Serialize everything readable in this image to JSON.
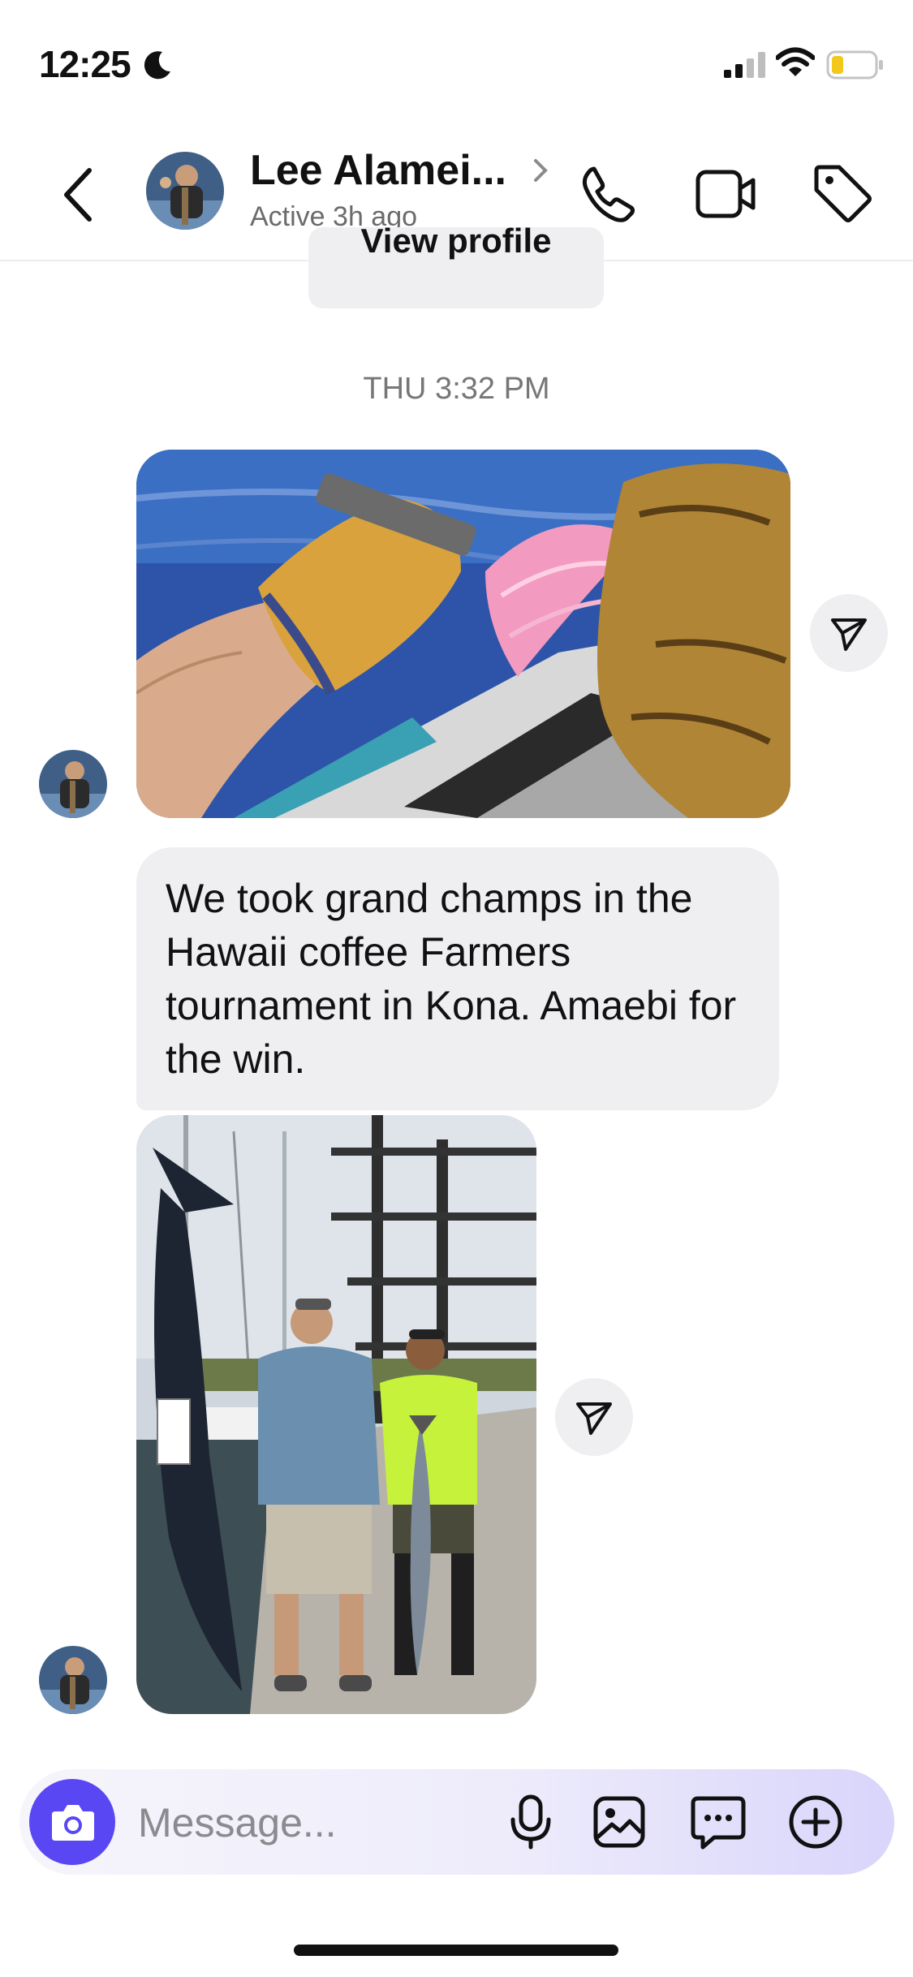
{
  "status_bar": {
    "time": "12:25",
    "icons": [
      "moon-icon",
      "cellular-signal-icon",
      "wifi-icon",
      "battery-icon"
    ]
  },
  "header": {
    "contact_name": "Lee Alamei...",
    "activity_status": "Active 3h ago",
    "icons": [
      "back-icon",
      "chevron-right-icon",
      "phone-icon",
      "video-camera-icon",
      "tag-icon"
    ]
  },
  "chat": {
    "view_profile_label": "View profile",
    "timestamp": "THU 3:32 PM",
    "messages": [
      {
        "type": "photo",
        "description_icon": "fishing-lure-photo"
      },
      {
        "type": "text",
        "text": "We took grand champs in the Hawaii coffee Farmers tournament in Kona. Amaebi for the win."
      },
      {
        "type": "photo",
        "description_icon": "marlin-catch-photo"
      }
    ]
  },
  "composer": {
    "placeholder": "Message...",
    "icons": [
      "camera-icon",
      "microphone-icon",
      "gallery-icon",
      "sticker-icon",
      "plus-circle-icon"
    ]
  },
  "colors": {
    "accent": "#5847f2",
    "bubble": "#efeff2",
    "secondary_text": "#6b6b6b"
  }
}
